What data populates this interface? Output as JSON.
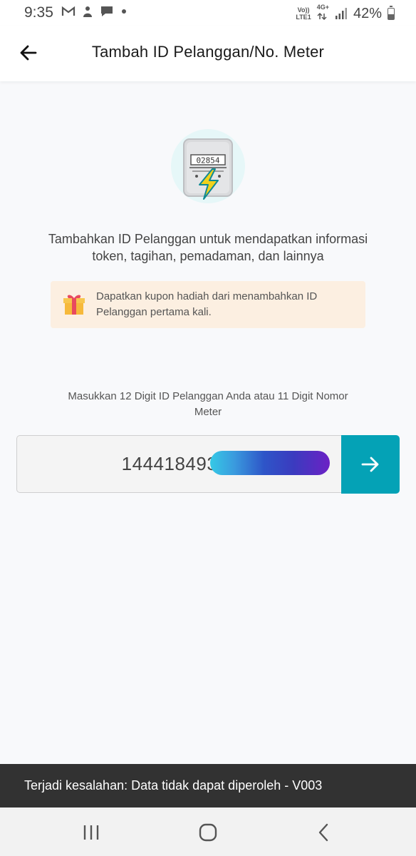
{
  "status_bar": {
    "time": "9:35",
    "notification_icons": [
      "gmail-icon",
      "app-icon",
      "message-icon",
      "dot-icon"
    ],
    "volte_label": "Vo))",
    "lte_label": "LTE1",
    "network_label": "4G+",
    "battery": "42%"
  },
  "header": {
    "title": "Tambah ID Pelanggan/No. Meter"
  },
  "illustration": {
    "meter_digits": "02854"
  },
  "intro": {
    "text_line1": "Tambahkan ID Pelanggan untuk mendapatkan informasi",
    "text_line2": "token, tagihan, pemadaman, dan lainnya"
  },
  "promo": {
    "text": "Dapatkan kupon hadiah dari menambahkan ID Pelanggan pertama kali."
  },
  "form": {
    "label_line1": "Masukkan 12 Digit ID Pelanggan Anda atau 11 Digit Nomor",
    "label_line2": "Meter",
    "input_value": "144418493"
  },
  "snackbar": {
    "message": "Terjadi kesalahan: Data tidak dapat diperoleh - V003"
  },
  "colors": {
    "accent": "#04a2b6",
    "promo_bg": "#fcefe1",
    "snackbar_bg": "#323232"
  }
}
